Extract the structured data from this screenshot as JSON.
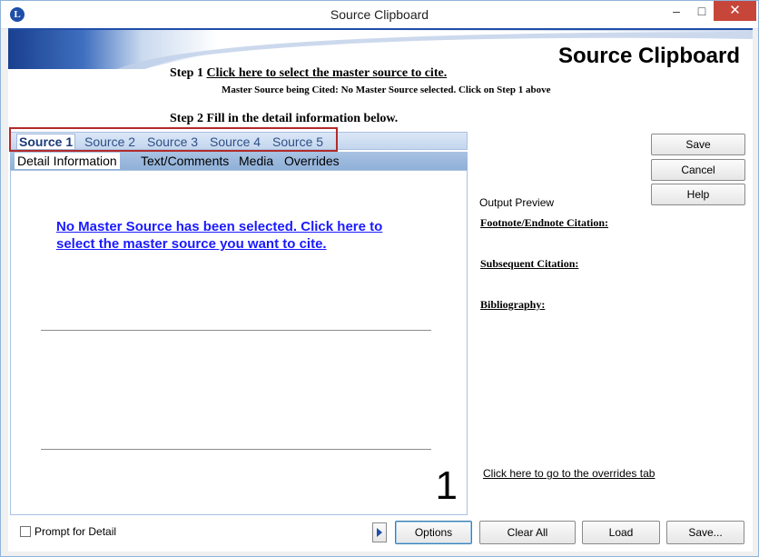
{
  "window": {
    "title": "Source Clipboard",
    "app_icon_letter": "L",
    "minimize_glyph": "–",
    "maximize_glyph": "□",
    "close_glyph": "✕"
  },
  "header": {
    "big_title": "Source Clipboard",
    "step1_prefix": "Step 1 ",
    "step1_link": "Click here to select the master source to cite.",
    "master_cited": "Master Source being Cited:  No Master Source selected.  Click on Step 1 above",
    "step2": "Step 2 Fill in the detail information below."
  },
  "source_tabs": [
    {
      "label": "Source 1",
      "active": true
    },
    {
      "label": "Source 2",
      "active": false
    },
    {
      "label": "Source 3",
      "active": false
    },
    {
      "label": "Source 4",
      "active": false
    },
    {
      "label": "Source 5",
      "active": false
    }
  ],
  "detail_tabs": [
    {
      "label": "Detail Information",
      "active": true
    },
    {
      "label": "Text/Comments",
      "active": false
    },
    {
      "label": "Media",
      "active": false
    },
    {
      "label": "Overrides",
      "active": false
    }
  ],
  "detail": {
    "no_master_link": "No Master Source has been selected.  Click here to select the master source you want to cite.",
    "source_number": "1"
  },
  "side_buttons": {
    "save": "Save",
    "cancel": "Cancel",
    "help": "Help"
  },
  "preview": {
    "label": "Output Preview",
    "footnote": "Footnote/Endnote Citation:",
    "subsequent": "Subsequent Citation:",
    "bibliography": "Bibliography:",
    "overrides_link": "Click here to go to the overrides tab"
  },
  "footer": {
    "prompt_label": "Prompt for Detail",
    "prompt_checked": false,
    "options": "Options",
    "clear_all": "Clear All",
    "load": "Load",
    "save_as": "Save..."
  },
  "colors": {
    "header_blue": "#1f4ea8",
    "link_blue": "#1a1aff",
    "highlight_red": "#b22a2a",
    "close_red": "#c7463a"
  }
}
